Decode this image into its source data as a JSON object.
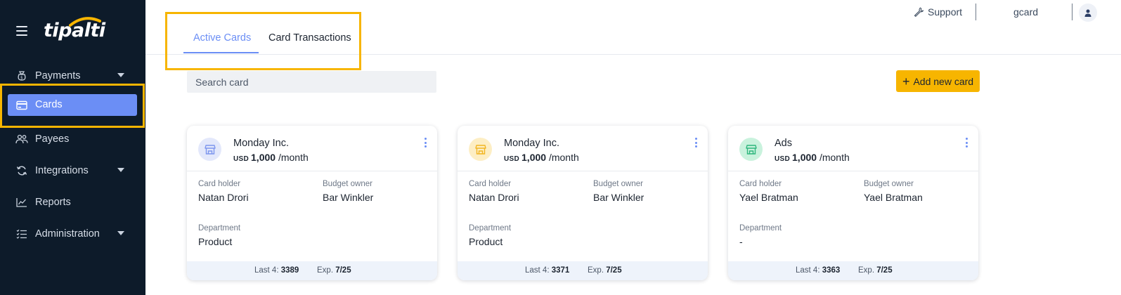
{
  "brand": {
    "logo_text": "tipalti"
  },
  "sidebar": {
    "items": [
      {
        "label": "Payments",
        "icon": "money-bag-icon",
        "has_caret": true
      },
      {
        "label": "Cards",
        "icon": "credit-card-icon",
        "active": true
      },
      {
        "label": "Payees",
        "icon": "people-icon"
      },
      {
        "label": "Integrations",
        "icon": "sync-icon",
        "has_caret": true
      },
      {
        "label": "Reports",
        "icon": "chart-line-icon"
      },
      {
        "label": "Administration",
        "icon": "list-check-icon",
        "has_caret": true
      }
    ]
  },
  "header": {
    "tabs": [
      {
        "label": "Active Cards",
        "active": true
      },
      {
        "label": "Card Transactions",
        "active": false
      }
    ],
    "support_label": "Support",
    "user_name": "gcard"
  },
  "toolbar": {
    "search_placeholder": "Search card",
    "add_label": "Add new card"
  },
  "cards": [
    {
      "name": "Monday Inc.",
      "currency": "USD",
      "amount": "1,000",
      "period": "/month",
      "icon_bg": "#e3e8fb",
      "icon_color": "#7d95ee",
      "card_holder_label": "Card holder",
      "card_holder": "Natan Drori",
      "budget_owner_label": "Budget owner",
      "budget_owner": "Bar Winkler",
      "department_label": "Department",
      "department": "Product",
      "last4_label": "Last 4:",
      "last4": "3389",
      "exp_label": "Exp.",
      "exp": "7/25"
    },
    {
      "name": "Monday Inc.",
      "currency": "USD",
      "amount": "1,000",
      "period": "/month",
      "icon_bg": "#fdeec4",
      "icon_color": "#f2b521",
      "card_holder_label": "Card holder",
      "card_holder": "Natan Drori",
      "budget_owner_label": "Budget owner",
      "budget_owner": "Bar Winkler",
      "department_label": "Department",
      "department": "Product",
      "last4_label": "Last 4:",
      "last4": "3371",
      "exp_label": "Exp.",
      "exp": "7/25"
    },
    {
      "name": "Ads",
      "currency": "USD",
      "amount": "1,000",
      "period": "/month",
      "icon_bg": "#c9f2dd",
      "icon_color": "#2eb67d",
      "card_holder_label": "Card holder",
      "card_holder": "Yael Bratman",
      "budget_owner_label": "Budget owner",
      "budget_owner": "Yael Bratman",
      "department_label": "Department",
      "department": "-",
      "last4_label": "Last 4:",
      "last4": "3363",
      "exp_label": "Exp.",
      "exp": "7/25"
    }
  ],
  "colors": {
    "sidebar_bg": "#0d1b2a",
    "accent": "#6b8ef5",
    "highlight": "#f7b500"
  }
}
